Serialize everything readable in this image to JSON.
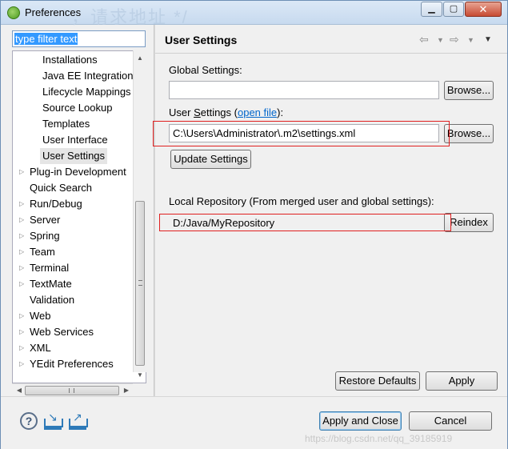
{
  "window": {
    "title": "Preferences",
    "title_overlay": "，请求地址 */"
  },
  "filter": {
    "value": "type filter text"
  },
  "tree": {
    "items": [
      {
        "label": "Installations",
        "level": 2,
        "arrow": false
      },
      {
        "label": "Java EE Integration",
        "level": 2,
        "arrow": false
      },
      {
        "label": "Lifecycle Mappings",
        "level": 2,
        "arrow": false
      },
      {
        "label": "Source Lookup",
        "level": 2,
        "arrow": false
      },
      {
        "label": "Templates",
        "level": 2,
        "arrow": false
      },
      {
        "label": "User Interface",
        "level": 2,
        "arrow": false
      },
      {
        "label": "User Settings",
        "level": 2,
        "arrow": false,
        "selected": true
      },
      {
        "label": "Plug-in Development",
        "level": 1,
        "arrow": true
      },
      {
        "label": "Quick Search",
        "level": 1,
        "arrow": false
      },
      {
        "label": "Run/Debug",
        "level": 1,
        "arrow": true
      },
      {
        "label": "Server",
        "level": 1,
        "arrow": true
      },
      {
        "label": "Spring",
        "level": 1,
        "arrow": true
      },
      {
        "label": "Team",
        "level": 1,
        "arrow": true
      },
      {
        "label": "Terminal",
        "level": 1,
        "arrow": true
      },
      {
        "label": "TextMate",
        "level": 1,
        "arrow": true
      },
      {
        "label": "Validation",
        "level": 1,
        "arrow": false
      },
      {
        "label": "Web",
        "level": 1,
        "arrow": true
      },
      {
        "label": "Web Services",
        "level": 1,
        "arrow": true
      },
      {
        "label": "XML",
        "level": 1,
        "arrow": true
      },
      {
        "label": "YEdit Preferences",
        "level": 1,
        "arrow": true
      }
    ]
  },
  "page": {
    "title": "User Settings",
    "global_settings": {
      "label": "Global Settings:",
      "value": "",
      "browse": "Browse..."
    },
    "user_settings": {
      "label_prefix": "User ",
      "label_u": "S",
      "label_rest": "ettings (",
      "link": "open file",
      "label_suffix": "):",
      "value": "C:\\Users\\Administrator\\.m2\\settings.xml",
      "browse": "Browse...",
      "update": "Update Settings"
    },
    "local_repo": {
      "label": "Local Repository (From merged user and global settings):",
      "value": "D:/Java/MyRepository",
      "reindex": "Reindex"
    },
    "restore_defaults": "Restore Defaults",
    "apply": "Apply"
  },
  "footer": {
    "apply_close": "Apply and Close",
    "cancel": "Cancel",
    "watermark": "https://blog.csdn.net/qq_39185919"
  },
  "colors": {
    "highlight": "#e02020",
    "link": "#0066cc",
    "selection": "#3399ff"
  }
}
